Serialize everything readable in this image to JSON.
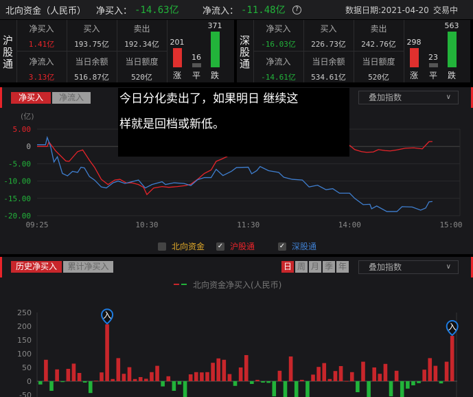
{
  "header": {
    "title": "北向资金（人民币）",
    "net_buy_label": "净买入：",
    "net_buy_value": "-14.63亿",
    "net_inflow_label": "净流入：",
    "net_inflow_value": "-11.48亿",
    "help_icon": "question-circle",
    "date_label": "数据日期:2021-04-20",
    "status": "交易中"
  },
  "sh": {
    "name": "沪股通",
    "net_buy_label": "净买入",
    "net_buy": "1.41亿",
    "buy_label": "买入",
    "buy": "193.75亿",
    "sell_label": "卖出",
    "sell": "192.34亿",
    "net_inflow_label": "净流入",
    "net_inflow": "3.13亿",
    "balance_label": "当日余额",
    "balance": "516.87亿",
    "quota_label": "当日额度",
    "quota": "520亿",
    "up": 201,
    "flat": 16,
    "down": 371,
    "up_label": "涨",
    "flat_label": "平",
    "down_label": "跌"
  },
  "sz": {
    "name": "深股通",
    "net_buy_label": "净买入",
    "net_buy": "-16.03亿",
    "buy_label": "买入",
    "buy": "226.73亿",
    "sell_label": "卖出",
    "sell": "242.76亿",
    "net_inflow_label": "净流入",
    "net_inflow": "-14.61亿",
    "balance_label": "当日余额",
    "balance": "534.61亿",
    "quota_label": "当日额度",
    "quota": "520亿",
    "up": 298,
    "flat": 23,
    "down": 563,
    "up_label": "涨",
    "flat_label": "平",
    "down_label": "跌"
  },
  "intraday": {
    "tab_active": "净买入",
    "tab_inactive": "净流入",
    "overlay_dropdown": "叠加指数",
    "legend": [
      {
        "label": "北向资金",
        "checked": false,
        "color": "#e0a92a"
      },
      {
        "label": "沪股通",
        "checked": true,
        "color": "#e8242a"
      },
      {
        "label": "深股通",
        "checked": true,
        "color": "#3f7fd0"
      }
    ]
  },
  "subtitle": {
    "line1": "今日分化卖出了，如果明日  继续这",
    "line2": "样就是回档或新低。"
  },
  "history": {
    "tab_active": "历史净买入",
    "tab_inactive": "累计净买入",
    "periods": [
      "日",
      "周",
      "月",
      "季",
      "年"
    ],
    "active_period": "日",
    "overlay_dropdown": "叠加指数",
    "marker_icon": "入"
  },
  "chart_data": [
    {
      "type": "line",
      "unit_label": "(亿)",
      "ylim": [
        -20,
        5
      ],
      "yticks": [
        "5.00",
        "0",
        "-5.00",
        "-10.00",
        "-15.00",
        "-20.00"
      ],
      "ytick_values": [
        5,
        0,
        -5,
        -10,
        -15,
        -20
      ],
      "xlim_trading_minutes": [
        0,
        245
      ],
      "xticks": [
        {
          "label": "09:25",
          "m": 0
        },
        {
          "label": "10:30",
          "m": 65
        },
        {
          "label": "11:30",
          "m": 125
        },
        {
          "label": "14:00",
          "m": 185
        },
        {
          "label": "15:00",
          "m": 245
        }
      ],
      "series": [
        {
          "name": "沪股通",
          "color": "#e8242a",
          "points": [
            [
              0,
              0
            ],
            [
              6,
              0
            ],
            [
              7,
              1.3
            ],
            [
              11,
              -1.3
            ],
            [
              17,
              -4.2
            ],
            [
              19,
              -4.3
            ],
            [
              24,
              -1.5
            ],
            [
              27,
              -1
            ],
            [
              31,
              -4
            ],
            [
              34,
              -6
            ],
            [
              38,
              -9.5
            ],
            [
              42,
              -11
            ],
            [
              46,
              -9.7
            ],
            [
              49,
              -9.5
            ],
            [
              53,
              -10.6
            ],
            [
              56,
              -10.5
            ],
            [
              60,
              -11
            ],
            [
              63,
              -11.8
            ],
            [
              65,
              -13.9
            ],
            [
              69,
              -12
            ],
            [
              74,
              -11.6
            ],
            [
              78,
              -11.8
            ],
            [
              83,
              -11.6
            ],
            [
              88,
              -11.3
            ],
            [
              91,
              -10.9
            ],
            [
              95,
              -9.5
            ],
            [
              99,
              -7.8
            ],
            [
              103,
              -6.8
            ],
            [
              106,
              -4.3
            ],
            [
              109,
              -3.7
            ],
            [
              113,
              -2.8
            ],
            [
              120,
              -1.5
            ],
            [
              128,
              -0.5
            ],
            [
              135,
              0.5
            ],
            [
              145,
              1.5
            ],
            [
              155,
              1
            ],
            [
              165,
              1.8
            ],
            [
              175,
              0.8
            ],
            [
              181,
              0.1
            ],
            [
              185,
              0.3
            ],
            [
              188,
              -0.9
            ],
            [
              192,
              -1.5
            ],
            [
              195,
              -1.7
            ],
            [
              199,
              -1.6
            ],
            [
              202,
              -0.9
            ],
            [
              206,
              -1.2
            ],
            [
              209,
              -1.3
            ],
            [
              213,
              -1
            ],
            [
              218,
              -0.5
            ],
            [
              223,
              -0.4
            ],
            [
              228,
              -0.7
            ],
            [
              232,
              1.4
            ],
            [
              234,
              1.4
            ]
          ]
        },
        {
          "name": "深股通",
          "color": "#3f7fd0",
          "points": [
            [
              0,
              0.5
            ],
            [
              5,
              0.5
            ],
            [
              6,
              2.6
            ],
            [
              8,
              0
            ],
            [
              10,
              -4.5
            ],
            [
              12,
              -3
            ],
            [
              15,
              -7.8
            ],
            [
              18,
              -8.5
            ],
            [
              21,
              -7.2
            ],
            [
              24,
              -7.5
            ],
            [
              26,
              -6
            ],
            [
              28,
              -6.2
            ],
            [
              31,
              -8.7
            ],
            [
              34,
              -9.7
            ],
            [
              38,
              -11.7
            ],
            [
              41,
              -12
            ],
            [
              45,
              -10.5
            ],
            [
              48,
              -10
            ],
            [
              52,
              -10.7
            ],
            [
              56,
              -10.2
            ],
            [
              60,
              -9.7
            ],
            [
              64,
              -12
            ],
            [
              68,
              -11
            ],
            [
              74,
              -10.2
            ],
            [
              76,
              -11
            ],
            [
              81,
              -10.5
            ],
            [
              87,
              -10.7
            ],
            [
              91,
              -11.3
            ],
            [
              95,
              -9.6
            ],
            [
              99,
              -9
            ],
            [
              103,
              -9
            ],
            [
              106,
              -6.6
            ],
            [
              110,
              -8.4
            ],
            [
              115,
              -7.2
            ],
            [
              118,
              -6.1
            ],
            [
              125,
              -6
            ],
            [
              127,
              -7.9
            ],
            [
              130,
              -7
            ],
            [
              132,
              -5.8
            ],
            [
              137,
              -7
            ],
            [
              143,
              -7.5
            ],
            [
              146,
              -8.9
            ],
            [
              151,
              -9.5
            ],
            [
              157,
              -9.7
            ],
            [
              161,
              -11.7
            ],
            [
              166,
              -11.2
            ],
            [
              171,
              -12.5
            ],
            [
              175,
              -12.2
            ],
            [
              179,
              -13.5
            ],
            [
              185,
              -13.5
            ],
            [
              188,
              -15
            ],
            [
              193,
              -16.8
            ],
            [
              197,
              -16.7
            ],
            [
              198,
              -18
            ],
            [
              201,
              -17.2
            ],
            [
              207,
              -18.8
            ],
            [
              213,
              -18.8
            ],
            [
              216,
              -17.4
            ],
            [
              222,
              -17.5
            ],
            [
              227,
              -18.4
            ],
            [
              230,
              -17.8
            ],
            [
              232,
              -16
            ],
            [
              234,
              -15.9
            ]
          ]
        }
      ]
    },
    {
      "type": "bar",
      "title": "北向资金净买入(人民币)",
      "ylim": [
        -50,
        250
      ],
      "yticks": [
        "250",
        "200",
        "150",
        "100",
        "50",
        "0",
        "-50"
      ],
      "ytick_values": [
        250,
        200,
        150,
        100,
        50,
        0,
        -50
      ],
      "pos_color": "#c8262b",
      "neg_color": "#22b33a",
      "values": [
        -12,
        78,
        -35,
        43,
        -3,
        45,
        64,
        30,
        -5,
        -43,
        2,
        32,
        207,
        8,
        84,
        27,
        51,
        8,
        15,
        9,
        33,
        56,
        -19,
        18,
        -35,
        -12,
        -60,
        25,
        33,
        32,
        33,
        67,
        83,
        78,
        26,
        -17,
        50,
        95,
        -10,
        5,
        -5,
        -6,
        -55,
        38,
        -60,
        90,
        -60,
        5,
        -60,
        24,
        52,
        66,
        8,
        37,
        55,
        1,
        33,
        -40,
        71,
        -60,
        50,
        27,
        63,
        -55,
        38,
        -60,
        -27,
        -15,
        -7,
        42,
        84,
        56,
        -8,
        71,
        165
      ],
      "markers": [
        12,
        74
      ]
    }
  ]
}
